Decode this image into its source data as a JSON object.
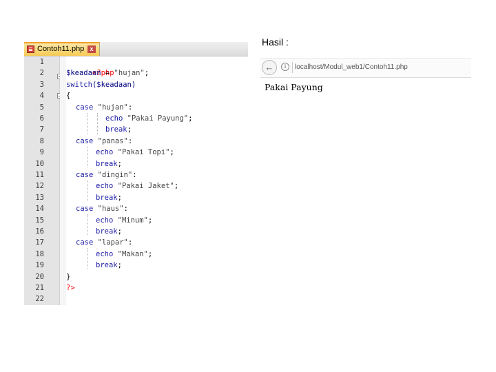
{
  "editor": {
    "tab_label": "Contoh11.php",
    "tab_close": "x",
    "line_numbers": [
      "1",
      "2",
      "3",
      "4",
      "5",
      "6",
      "7",
      "8",
      "9",
      "10",
      "11",
      "12",
      "13",
      "14",
      "15",
      "16",
      "17",
      "18",
      "19",
      "20",
      "21",
      "22"
    ]
  },
  "code": {
    "l1": "<?php",
    "l2_var": "$keadaan",
    "l2_rest": " = ",
    "l2_str": "\"hujan\"",
    "l2_end": ";",
    "l3_kw": "switch",
    "l3_rest": "($keadaan)",
    "l4": "{",
    "case_kw": "case",
    "echo_kw": "echo",
    "break_kw": "break",
    "semicolon": ";",
    "colon": ":",
    "cases": [
      {
        "value": "\"hujan\"",
        "echo": "\"Pakai Payung\""
      },
      {
        "value": "\"panas\"",
        "echo": "\"Pakai Topi\""
      },
      {
        "value": "\"dingin\"",
        "echo": "\"Pakai Jaket\""
      },
      {
        "value": "\"haus\"",
        "echo": "\"Minum\""
      },
      {
        "value": "\"lapar\"",
        "echo": "\"Makan\""
      }
    ],
    "l20": "}",
    "l21": "?>"
  },
  "result": {
    "heading": "Hasil :",
    "back_icon": "arrow-left-icon",
    "info_icon": "info-icon",
    "url": "localhost/Modul_web1/Contoh11.php",
    "output": "Pakai Payung"
  }
}
